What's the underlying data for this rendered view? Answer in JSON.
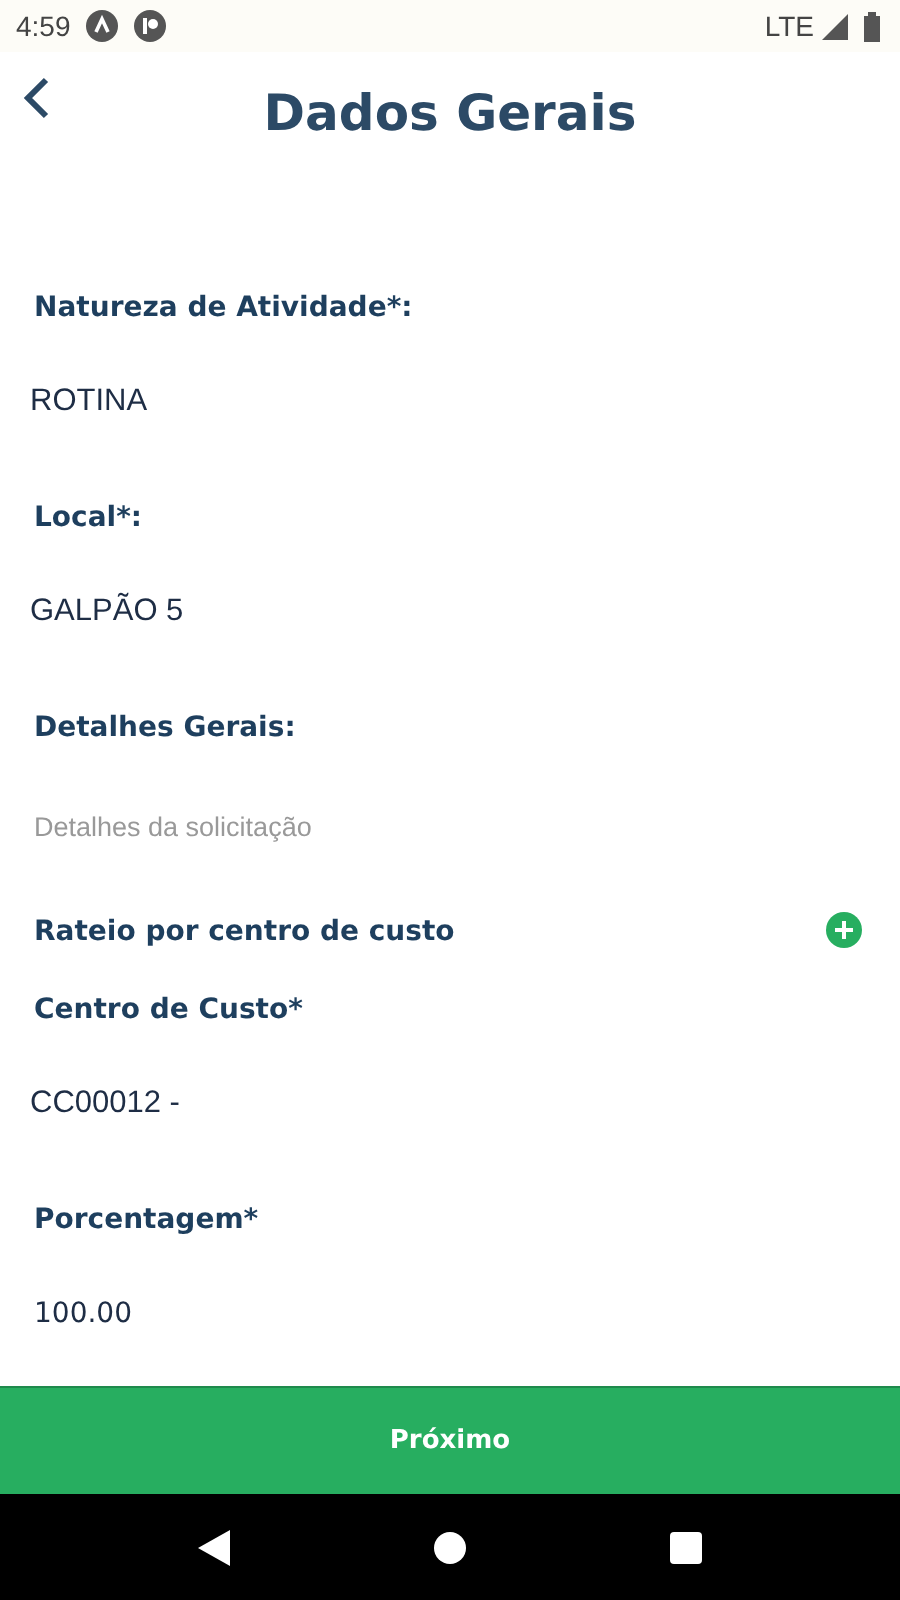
{
  "status_bar": {
    "time": "4:59",
    "network": "LTE"
  },
  "header": {
    "title": "Dados Gerais"
  },
  "fields": [
    {
      "kind": "label",
      "text": "Natureza de Atividade*:"
    },
    {
      "kind": "value",
      "text": "ROTINA"
    },
    {
      "kind": "label",
      "text": "Local*:"
    },
    {
      "kind": "value",
      "text": "GALPÃO 5"
    },
    {
      "kind": "label",
      "text": "Detalhes Gerais:"
    },
    {
      "kind": "placeholder",
      "placeholder": "Detalhes da solicitação"
    },
    {
      "kind": "section",
      "text": "Rateio por centro de custo"
    },
    {
      "kind": "label",
      "text": "Centro de Custo*"
    },
    {
      "kind": "value",
      "text": "CC00012 -"
    },
    {
      "kind": "label",
      "text": "Porcentagem*"
    },
    {
      "kind": "small",
      "text": "100.00"
    }
  ],
  "next_button": "Próximo"
}
